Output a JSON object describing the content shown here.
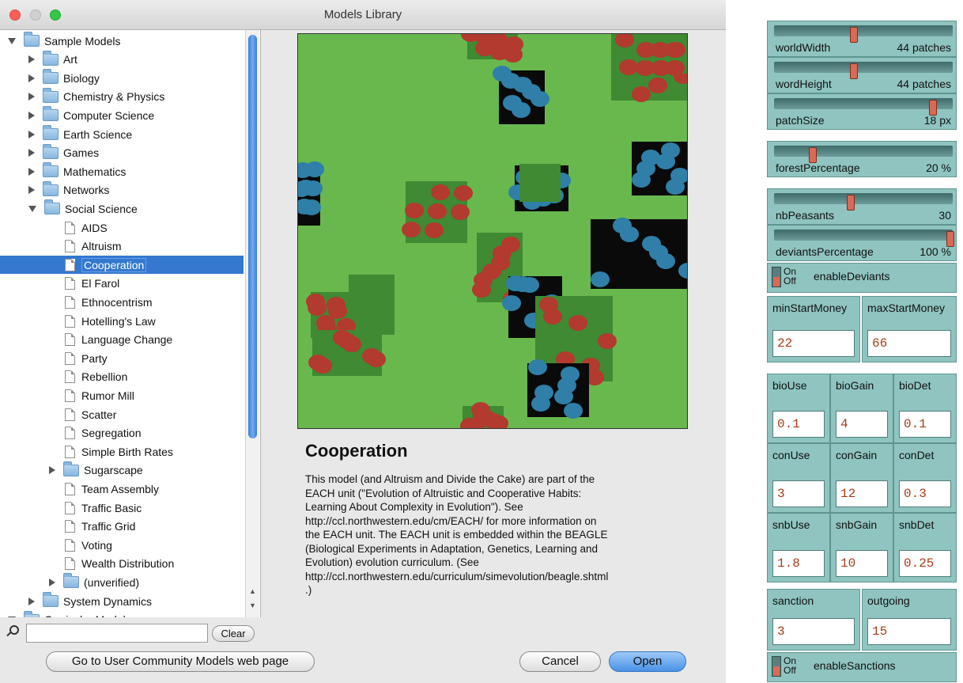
{
  "window": {
    "title": "Models Library"
  },
  "tree": {
    "items": [
      {
        "label": "Sample Models",
        "kind": "folder",
        "depth": 0,
        "expanded": true
      },
      {
        "label": "Art",
        "kind": "folder",
        "depth": 1,
        "expanded": false
      },
      {
        "label": "Biology",
        "kind": "folder",
        "depth": 1,
        "expanded": false
      },
      {
        "label": "Chemistry & Physics",
        "kind": "folder",
        "depth": 1,
        "expanded": false
      },
      {
        "label": "Computer Science",
        "kind": "folder",
        "depth": 1,
        "expanded": false
      },
      {
        "label": "Earth Science",
        "kind": "folder",
        "depth": 1,
        "expanded": false
      },
      {
        "label": "Games",
        "kind": "folder",
        "depth": 1,
        "expanded": false
      },
      {
        "label": "Mathematics",
        "kind": "folder",
        "depth": 1,
        "expanded": false
      },
      {
        "label": "Networks",
        "kind": "folder",
        "depth": 1,
        "expanded": false
      },
      {
        "label": "Social Science",
        "kind": "folder",
        "depth": 1,
        "expanded": true
      },
      {
        "label": "AIDS",
        "kind": "model",
        "depth": 2
      },
      {
        "label": "Altruism",
        "kind": "model",
        "depth": 2
      },
      {
        "label": "Cooperation",
        "kind": "model",
        "depth": 2,
        "selected": true
      },
      {
        "label": "El Farol",
        "kind": "model",
        "depth": 2
      },
      {
        "label": "Ethnocentrism",
        "kind": "model",
        "depth": 2
      },
      {
        "label": "Hotelling's Law",
        "kind": "model",
        "depth": 2
      },
      {
        "label": "Language Change",
        "kind": "model",
        "depth": 2
      },
      {
        "label": "Party",
        "kind": "model",
        "depth": 2
      },
      {
        "label": "Rebellion",
        "kind": "model",
        "depth": 2
      },
      {
        "label": "Rumor Mill",
        "kind": "model",
        "depth": 2
      },
      {
        "label": "Scatter",
        "kind": "model",
        "depth": 2
      },
      {
        "label": "Segregation",
        "kind": "model",
        "depth": 2
      },
      {
        "label": "Simple Birth Rates",
        "kind": "model",
        "depth": 2
      },
      {
        "label": "Sugarscape",
        "kind": "folder",
        "depth": 2,
        "expanded": false
      },
      {
        "label": "Team Assembly",
        "kind": "model",
        "depth": 2
      },
      {
        "label": "Traffic Basic",
        "kind": "model",
        "depth": 2
      },
      {
        "label": "Traffic Grid",
        "kind": "model",
        "depth": 2
      },
      {
        "label": "Voting",
        "kind": "model",
        "depth": 2
      },
      {
        "label": "Wealth Distribution",
        "kind": "model",
        "depth": 2
      },
      {
        "label": "(unverified)",
        "kind": "folder",
        "depth": 2,
        "expanded": false
      },
      {
        "label": "System Dynamics",
        "kind": "folder",
        "depth": 1,
        "expanded": false
      },
      {
        "label": "Curricular Models",
        "kind": "folder",
        "depth": 0,
        "expanded": true
      }
    ]
  },
  "search": {
    "value": "",
    "clear_label": "Clear"
  },
  "model": {
    "title": "Cooperation",
    "description_lines": [
      "This model (and Altruism and Divide the Cake) are part of the",
      "EACH unit (\"Evolution of Altruistic and Cooperative Habits:",
      "Learning About Complexity in Evolution\"). See",
      "http://ccl.northwestern.edu/cm/EACH/ for more information on",
      "the EACH unit. The EACH unit is embedded within the BEAGLE",
      "(Biological Experiments in Adaptation, Genetics, Learning and",
      "Evolution) evolution curriculum. (See",
      "http://ccl.northwestern.edu/curriculum/simevolution/beagle.shtml",
      ".)"
    ]
  },
  "buttons": {
    "community": "Go to User Community Models web page",
    "cancel": "Cancel",
    "open": "Open"
  },
  "colors": {
    "selection": "#3478d0",
    "patch_green": "#68b84e",
    "patch_dark": "#3f8a32",
    "red_agent": "#b23a2f",
    "blue_agent": "#2f7fa8",
    "widget_teal": "#8fc4c0"
  },
  "interface": {
    "sliders": [
      {
        "name": "worldWidth",
        "value": "44 patches",
        "fraction": 0.44
      },
      {
        "name": "wordHeight",
        "value": "44 patches",
        "fraction": 0.44
      },
      {
        "name": "patchSize",
        "value": "18 px",
        "fraction": 0.9
      },
      {
        "name": "forestPercentage",
        "value": "20 %",
        "fraction": 0.2
      },
      {
        "name": "nbPeasants",
        "value": "30",
        "fraction": 0.42
      },
      {
        "name": "deviantsPercentage",
        "value": "100 %",
        "fraction": 1.0
      }
    ],
    "switches": [
      {
        "name": "enableDeviants",
        "on_label": "On",
        "off_label": "Off",
        "state": "off"
      },
      {
        "name": "enableSanctions",
        "on_label": "On",
        "off_label": "Off",
        "state": "off"
      }
    ],
    "inputs": [
      {
        "label": "minStartMoney",
        "value": "22"
      },
      {
        "label": "maxStartMoney",
        "value": "66"
      },
      {
        "label": "bioUse",
        "value": "0.1"
      },
      {
        "label": "bioGain",
        "value": "4"
      },
      {
        "label": "bioDet",
        "value": "0.1"
      },
      {
        "label": "conUse",
        "value": "3"
      },
      {
        "label": "conGain",
        "value": "12"
      },
      {
        "label": "conDet",
        "value": "0.3"
      },
      {
        "label": "snbUse",
        "value": "1.8"
      },
      {
        "label": "snbGain",
        "value": "10"
      },
      {
        "label": "snbDet",
        "value": "0.25"
      },
      {
        "label": "sanction",
        "value": "3"
      },
      {
        "label": "outgoing",
        "value": "15"
      }
    ]
  }
}
